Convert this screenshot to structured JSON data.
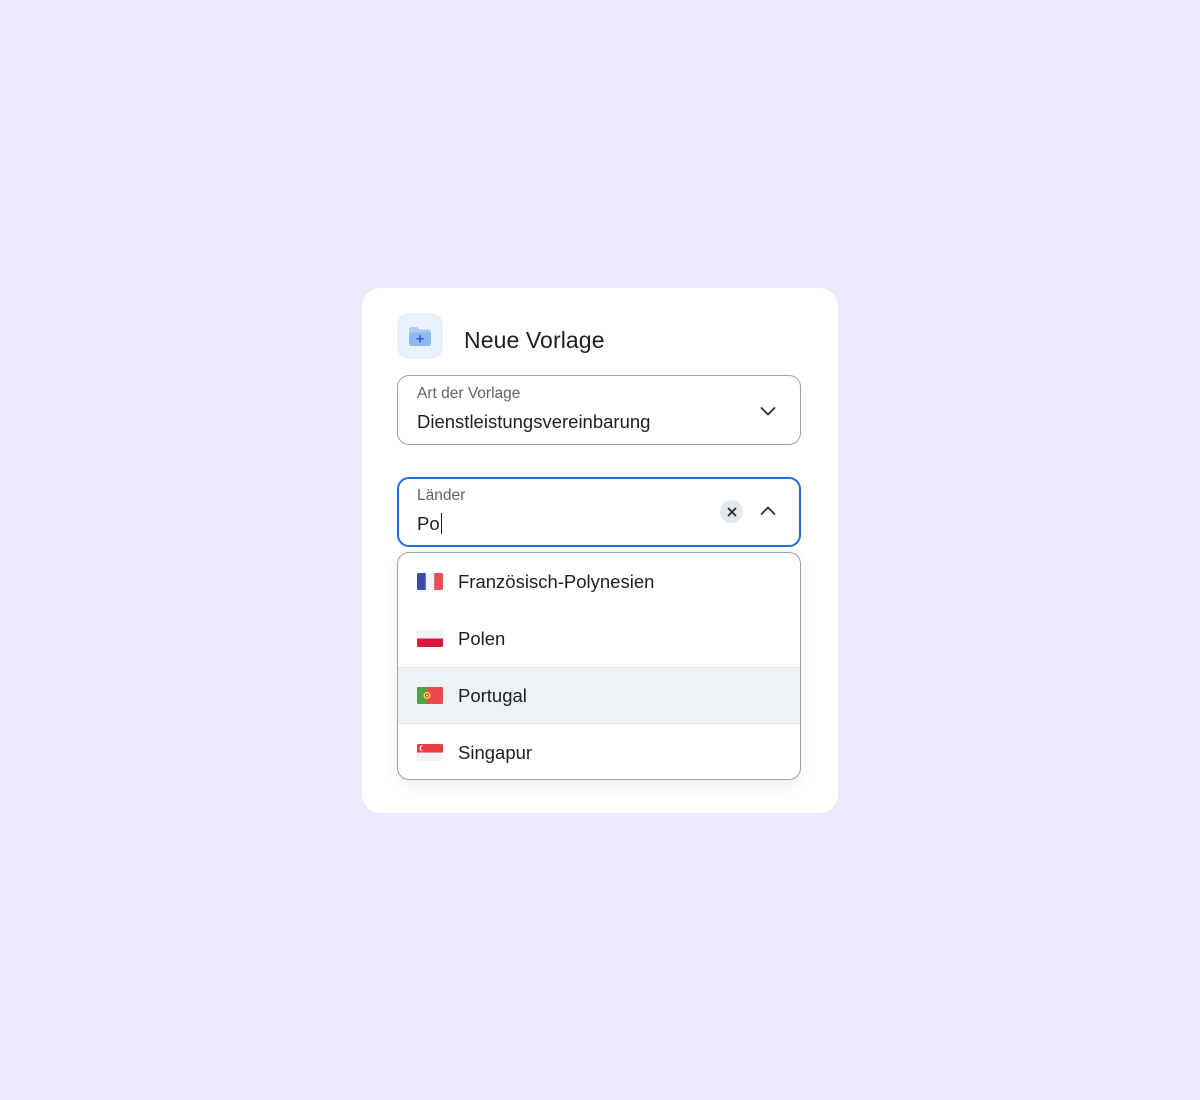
{
  "dialog": {
    "title": "Neue Vorlage",
    "icon": "folder-add-icon"
  },
  "template_field": {
    "label": "Art der Vorlage",
    "value": "Dienstleistungsvereinbarung",
    "expanded": false
  },
  "countries_field": {
    "label": "Länder",
    "value": "Po",
    "focused": true,
    "expanded": true
  },
  "dropdown": {
    "highlighted_index": 2,
    "options": [
      {
        "label": "Französisch-Polynesien",
        "flag": "france-flag-icon"
      },
      {
        "label": "Polen",
        "flag": "poland-flag-icon"
      },
      {
        "label": "Portugal",
        "flag": "portugal-flag-icon"
      },
      {
        "label": "Singapur",
        "flag": "singapore-flag-icon"
      }
    ]
  },
  "colors": {
    "background": "#EEE8FE",
    "focus_border": "#1F6FD1",
    "icon_tile": "#E8F1FD",
    "highlight_row": "#EEF2F5"
  }
}
